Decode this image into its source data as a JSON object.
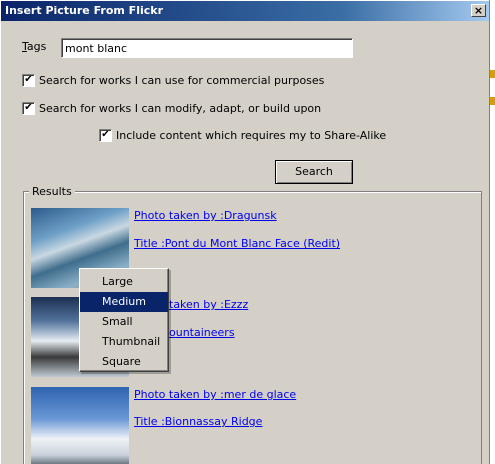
{
  "window": {
    "title": "Insert Picture From Flickr",
    "close_glyph": "×"
  },
  "form": {
    "tags_label": "Tags",
    "tags_value": "mont blanc",
    "options": [
      {
        "label": "Search for works I can use for commercial purposes",
        "checked": "✔"
      },
      {
        "label": "Search for works I can modify, adapt, or build upon",
        "checked": "✔"
      },
      {
        "label": "Include content which requires my to Share-Alike",
        "checked": "✔"
      }
    ],
    "search_label": "Search"
  },
  "results": {
    "legend": "Results",
    "items": [
      {
        "photo_by": "Photo taken by :Dragunsk",
        "title": "Title :Pont du Mont Blanc Face (Redit)"
      },
      {
        "photo_by": "taken by :Ezzz",
        "title": "ountaineers"
      },
      {
        "photo_by": "Photo taken by :mer de glace",
        "title": "Title :Bionnassay Ridge"
      }
    ]
  },
  "size_menu": {
    "items": [
      "Large",
      "Medium",
      "Small",
      "Thumbnail",
      "Square"
    ],
    "selected": "Medium"
  }
}
